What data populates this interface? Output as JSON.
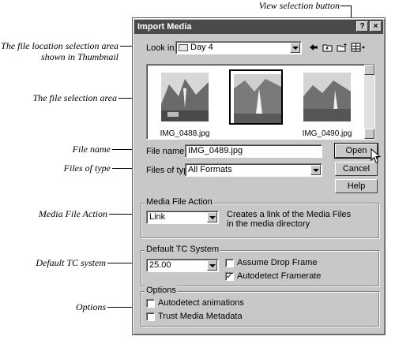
{
  "annotations": {
    "view_selection": "View selection button",
    "file_location_line1": "The file location selection area",
    "file_location_line2": "shown in Thumbnail",
    "file_selection": "The file selection area",
    "file_name": "File name",
    "files_of_type": "Files of type",
    "media_file_action": "Media File Action",
    "default_tc": "Default TC system",
    "options": "Options"
  },
  "dialog": {
    "title": "Import Media",
    "title_buttons": [
      "?",
      "×"
    ],
    "look_in_label": "Look in:",
    "look_in_value": "Day 4",
    "thumbnails": [
      {
        "caption": "IMG_0488.jpg",
        "selected": false
      },
      {
        "caption": "IMG_0489.jpg",
        "selected": true
      },
      {
        "caption": "IMG_0490.jpg",
        "selected": false
      }
    ],
    "file_name_label": "File name:",
    "file_name_value": "IMG_0489.jpg",
    "files_type_label": "Files of type:",
    "files_type_value": "All Formats",
    "buttons": {
      "open": "Open",
      "cancel": "Cancel",
      "help": "Help"
    },
    "media_file_action": {
      "title": "Media File Action",
      "value": "Link",
      "description_line1": "Creates a link of the Media Files",
      "description_line2": "in the media directory"
    },
    "tc_system": {
      "title": "Default TC System",
      "value": "25.00",
      "assume_drop_frame": {
        "label": "Assume Drop Frame",
        "checked": false
      },
      "autodetect_framerate": {
        "label": "Autodetect Framerate",
        "checked": true
      }
    },
    "options": {
      "title": "Options",
      "autodetect_animations": {
        "label": "Autodetect animations",
        "checked": false
      },
      "trust_metadata": {
        "label": "Trust Media Metadata",
        "checked": false
      }
    }
  }
}
